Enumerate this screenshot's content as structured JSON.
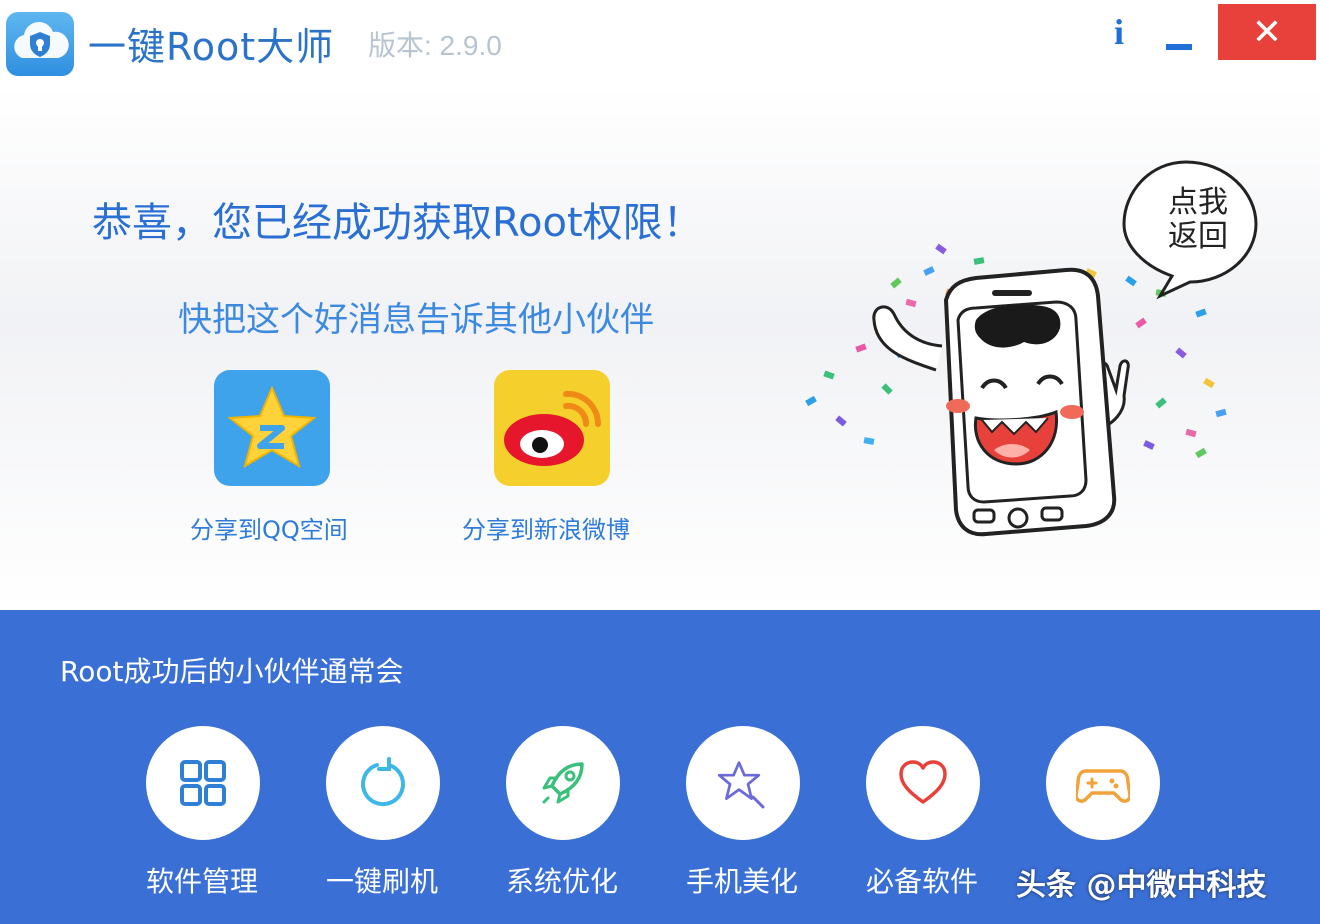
{
  "window": {
    "title": "一键Root大师",
    "version": "版本: 2.9.0",
    "info_label": "i",
    "close_label": "✕"
  },
  "hero": {
    "congrats": "恭喜，您已经成功获取Root权限！",
    "share_prompt": "快把这个好消息告诉其他小伙伴",
    "share_qq": "分享到QQ空间",
    "share_weibo": "分享到新浪微博",
    "bubble": "点我返回"
  },
  "panel": {
    "title": "Root成功后的小伙伴通常会",
    "features": [
      {
        "label": "软件管理",
        "icon": "grid-icon"
      },
      {
        "label": "一键刷机",
        "icon": "refresh-icon"
      },
      {
        "label": "系统优化",
        "icon": "rocket-icon"
      },
      {
        "label": "手机美化",
        "icon": "magic-star-icon"
      },
      {
        "label": "必备软件",
        "icon": "heart-icon"
      },
      {
        "label": "",
        "icon": "gamepad-icon"
      }
    ],
    "watermark": "头条 @中微中科技"
  },
  "colors": {
    "accent": "#2a6fd3",
    "panel_bg": "#3a6fd6",
    "close_bg": "#e8413c"
  }
}
